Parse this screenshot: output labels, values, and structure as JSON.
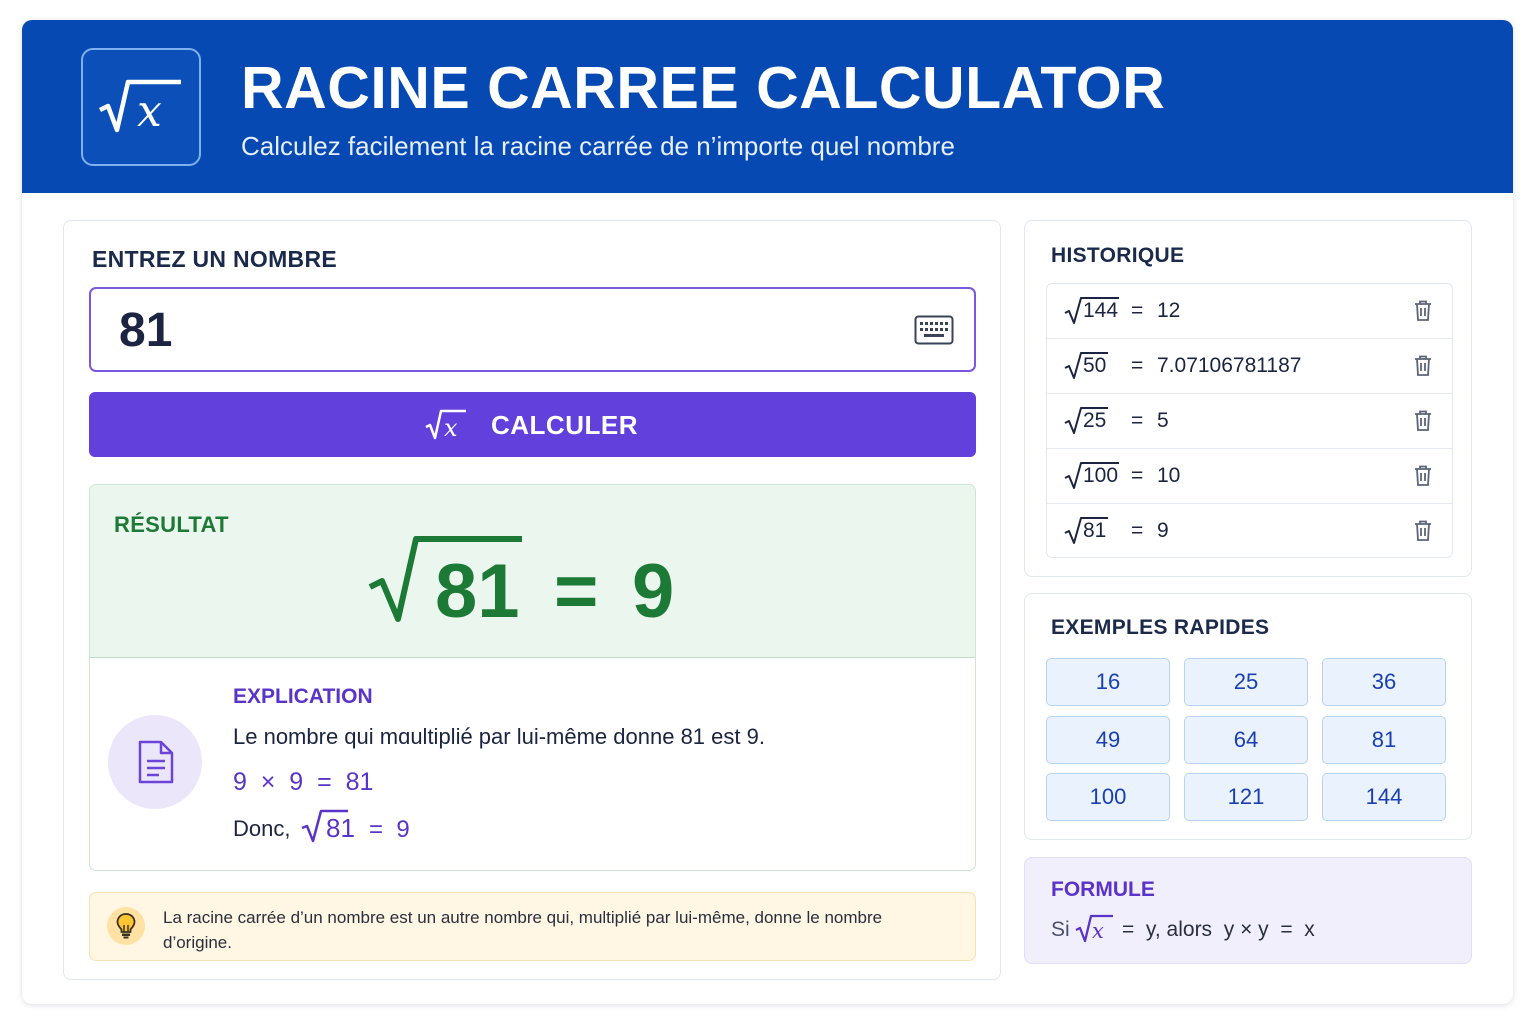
{
  "header": {
    "title": "RACINE CARREE CALCULATOR",
    "subtitle": "Calculez facilement la racine carrée de n’importe quel nombre",
    "logo_icon": "square-root-x-icon"
  },
  "input_section": {
    "label": "ENTREZ UN NOMBRE",
    "value": "81",
    "keyboard_icon": "keyboard-icon"
  },
  "calculate_button": {
    "label": "CALCULER",
    "icon": "square-root-x-icon"
  },
  "result": {
    "label": "RÉSULTAT",
    "radicand": "81",
    "equals": "=",
    "value": "9"
  },
  "explanation": {
    "label": "EXPLICATION",
    "text": "Le nombre qui mɑultiplié par lui-même donne 81 est 9.",
    "multiplication": "9  ×  9  =  81",
    "donc_prefix": "Donc,",
    "donc_radicand": "81",
    "donc_result": "=  9",
    "icon": "document-icon"
  },
  "tip": {
    "text": "La racine carrée d’un nombre est un autre nombre qui, multiplié par lui-même, donne le nombre d’origine.",
    "icon": "lightbulb-icon"
  },
  "history": {
    "label": "HISTORIQUE",
    "items": [
      {
        "radicand": "144",
        "equals": "=",
        "value": "12"
      },
      {
        "radicand": "50",
        "equals": "=",
        "value": "7.07106781187"
      },
      {
        "radicand": "25",
        "equals": "=",
        "value": "5"
      },
      {
        "radicand": "100",
        "equals": "=",
        "value": "10"
      },
      {
        "radicand": "81",
        "equals": "=",
        "value": "9"
      }
    ],
    "delete_icon": "trash-icon"
  },
  "examples": {
    "label": "EXEMPLES RAPIDES",
    "items": [
      "16",
      "25",
      "36",
      "49",
      "64",
      "81",
      "100",
      "121",
      "144"
    ]
  },
  "formula": {
    "label": "FORMULE",
    "si": "Si",
    "rest": "=  y, alors  y × y  =  x"
  },
  "colors": {
    "header": "#0649b3",
    "accent": "#6140dc",
    "result_green": "#1c7a36",
    "example_bg": "#e9f2fd"
  }
}
